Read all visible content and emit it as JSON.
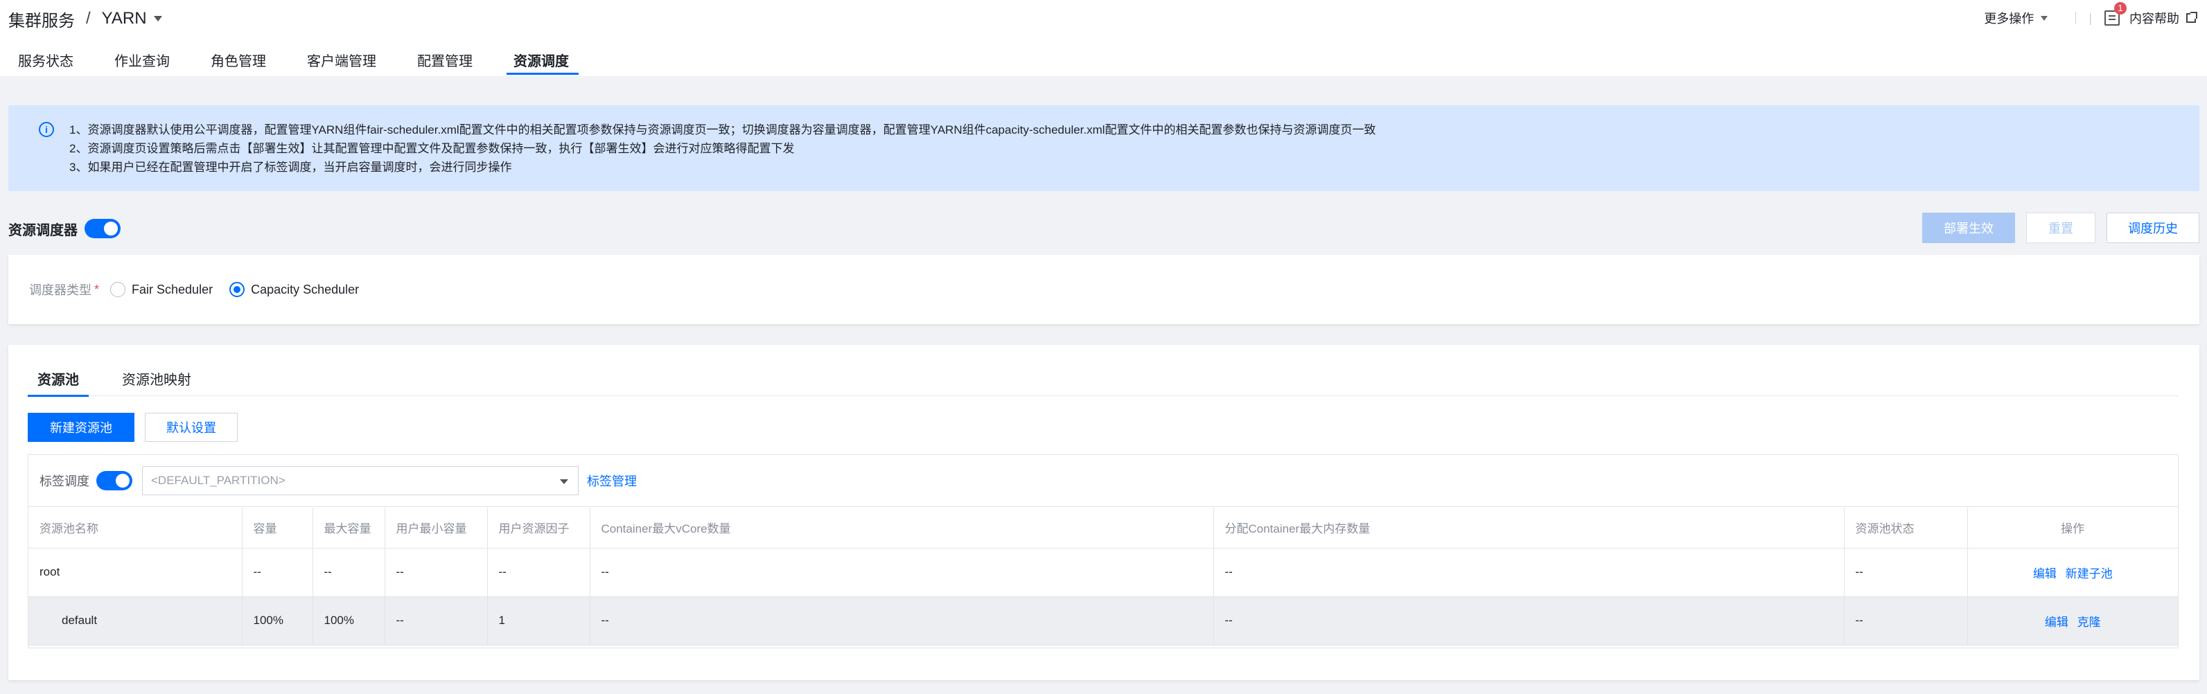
{
  "header": {
    "crumb_root": "集群服务",
    "crumb_sep": "/",
    "crumb_current": "YARN",
    "more_ops": "更多操作",
    "task_badge": "1",
    "help": "内容帮助"
  },
  "tabs": [
    "服务状态",
    "作业查询",
    "角色管理",
    "客户端管理",
    "配置管理",
    "资源调度"
  ],
  "active_tab": "资源调度",
  "notice": {
    "lines": [
      "1、资源调度器默认使用公平调度器，配置管理YARN组件fair-scheduler.xml配置文件中的相关配置项参数保持与资源调度页一致；切换调度器为容量调度器，配置管理YARN组件capacity-scheduler.xml配置文件中的相关配置参数也保持与资源调度页一致",
      "2、资源调度页设置策略后需点击【部署生效】让其配置管理中配置文件及配置参数保持一致，执行【部署生效】会进行对应策略得配置下发",
      "3、如果用户已经在配置管理中开启了标签调度，当开启容量调度时，会进行同步操作"
    ]
  },
  "scheduler": {
    "title": "资源调度器",
    "enabled": true,
    "deploy_label": "部署生效",
    "reset_label": "重置",
    "history_label": "调度历史",
    "type_label": "调度器类型",
    "required_mark": "*",
    "options": [
      "Fair Scheduler",
      "Capacity Scheduler"
    ],
    "selected": "Capacity Scheduler"
  },
  "pool": {
    "tabs": [
      "资源池",
      "资源池映射"
    ],
    "active_tab": "资源池",
    "new_label": "新建资源池",
    "default_label": "默认设置",
    "tag_label": "标签调度",
    "tag_enabled": true,
    "partition_placeholder": "<DEFAULT_PARTITION>",
    "tag_mgmt": "标签管理",
    "columns": [
      "资源池名称",
      "容量",
      "最大容量",
      "用户最小容量",
      "用户资源因子",
      "Container最大vCore数量",
      "分配Container最大内存数量",
      "资源池状态",
      "操作"
    ],
    "rows": [
      {
        "cells": [
          "root",
          "--",
          "--",
          "--",
          "--",
          "--",
          "--",
          "--"
        ],
        "actions": [
          "编辑",
          "新建子池"
        ]
      },
      {
        "cells": [
          "default",
          "100%",
          "100%",
          "--",
          "1",
          "--",
          "--",
          "--"
        ],
        "actions": [
          "编辑",
          "克隆"
        ]
      }
    ]
  },
  "colors": {
    "accent": "#006eff",
    "notice_bg": "#d6e6ff",
    "disabled_btn": "#a9c8f5",
    "badge": "#e34d59"
  }
}
